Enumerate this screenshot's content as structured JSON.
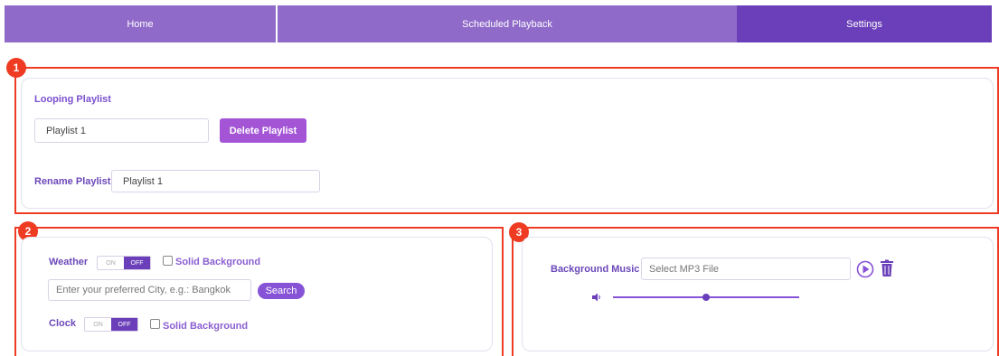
{
  "nav": {
    "tabs": [
      {
        "label": "Home"
      },
      {
        "label": "Scheduled Playback"
      },
      {
        "label": "Settings"
      }
    ]
  },
  "annotations": [
    "1",
    "2",
    "3"
  ],
  "playlist": {
    "title": "Looping Playlist",
    "selected": "Playlist 1",
    "delete_label": "Delete Playlist",
    "rename_label": "Rename Playlist",
    "rename_value": "Playlist 1"
  },
  "weather": {
    "label": "Weather",
    "toggle_on": "ON",
    "toggle_off": "OFF",
    "state": "OFF",
    "solid_bg_label": "Solid Background",
    "city_placeholder": "Enter your preferred City, e.g.: Bangkok",
    "search_label": "Search"
  },
  "clock": {
    "label": "Clock",
    "toggle_on": "ON",
    "toggle_off": "OFF",
    "state": "OFF",
    "solid_bg_label": "Solid Background"
  },
  "music": {
    "label": "Background Music",
    "file_placeholder": "Select MP3 File",
    "volume_fraction": 0.5,
    "icons": [
      "volume-icon",
      "play-icon",
      "trash-icon"
    ]
  },
  "colors": {
    "accent": "#6a3fb9",
    "nav": "#8f6ac9",
    "annotation": "#ee3b22"
  }
}
